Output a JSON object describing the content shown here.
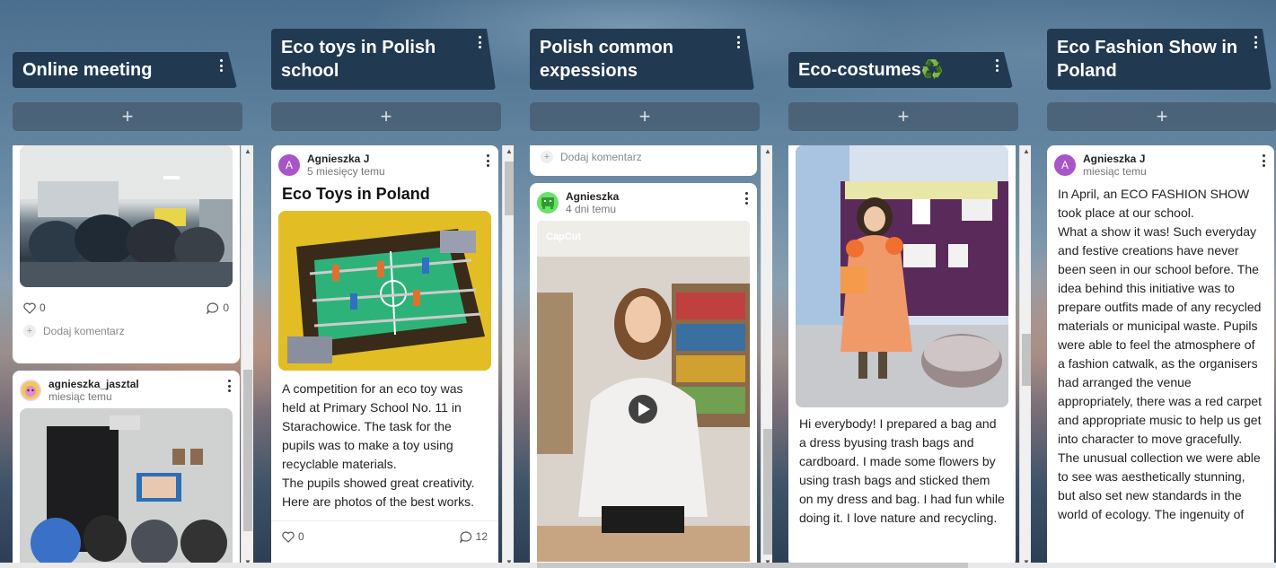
{
  "columns": [
    {
      "title": "Online meeting",
      "add_label": "+",
      "cards": [
        {
          "likes": "0",
          "comments": "0",
          "comment_placeholder": "Dodaj komentarz"
        },
        {
          "author": "agnieszka_jasztal",
          "time": "miesiąc temu"
        }
      ]
    },
    {
      "title": "Eco toys in Polish school",
      "add_label": "+",
      "cards": [
        {
          "avatar": "A",
          "author": "Agnieszka J",
          "time": "5 miesięcy temu",
          "title": "Eco Toys in Poland",
          "text": "A competition for an eco toy was held at Primary School No. 11 in Starachowice. The task for the pupils was to make a toy using recyclable materials.\nThe pupils showed great creativity.  Here are photos of the best works.",
          "likes": "0",
          "comments": "12"
        }
      ]
    },
    {
      "title": "Polish common expessions",
      "add_label": "+",
      "cards": [
        {
          "comment_placeholder": "Dodaj komentarz"
        },
        {
          "author": "Agnieszka",
          "time": "4 dni temu",
          "video_watermark": "CapCut"
        }
      ]
    },
    {
      "title": "Eco-costumes♻️",
      "add_label": "+",
      "cards": [
        {
          "text": "Hi everybody! I prepared a bag and a dress byusing trash bags and cardboard. I made some flowers by using trash bags and sticked them on my dress and bag. I had fun while doing it. I love nature and recycling."
        }
      ]
    },
    {
      "title": "Eco Fashion Show in Poland",
      "add_label": "+",
      "cards": [
        {
          "avatar": "A",
          "author": "Agnieszka J",
          "time": "miesiąc temu",
          "text": "In April, an ECO FASHION SHOW took place at our school.\nWhat a show it was! Such everyday and festive creations have never been seen in our school before. The idea behind this initiative was to prepare outfits made of any recycled materials or municipal waste. Pupils were able to feel the atmosphere of a fashion catwalk, as the organisers had arranged the venue appropriately, there was a red carpet and appropriate music to help us get into character to move gracefully. The unusual collection we were able to see was aesthetically stunning, but also set new standards in the world of ecology. The ingenuity of"
        }
      ]
    }
  ],
  "colors": {
    "header_bg": "#213a52",
    "avatar_purple": "#a855c7",
    "avatar_green": "#3cc63c"
  }
}
